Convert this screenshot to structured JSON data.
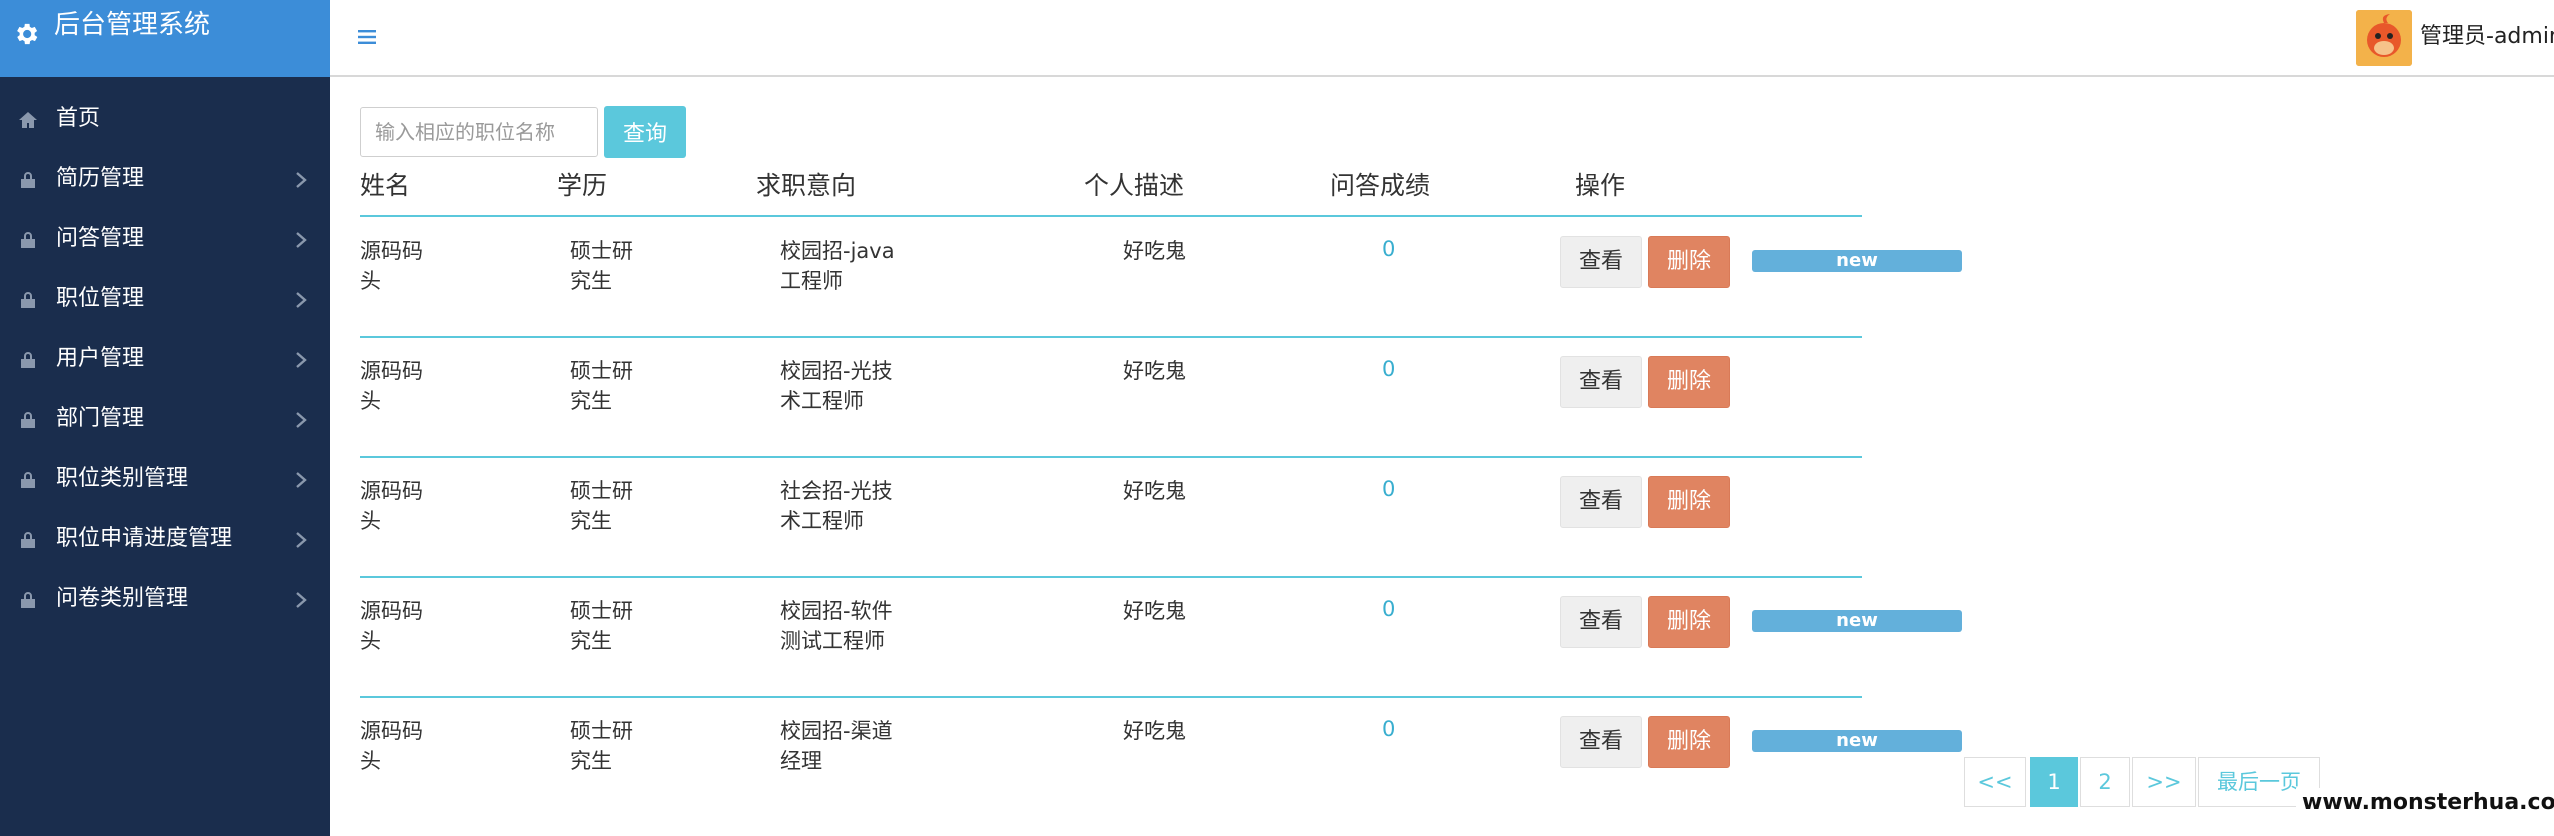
{
  "app": {
    "title": "后台管理系统",
    "user": "管理员-admin"
  },
  "sidebar": {
    "items": [
      {
        "label": "首页",
        "has_children": false
      },
      {
        "label": "简历管理",
        "has_children": true
      },
      {
        "label": "问答管理",
        "has_children": true
      },
      {
        "label": "职位管理",
        "has_children": true
      },
      {
        "label": "用户管理",
        "has_children": true
      },
      {
        "label": "部门管理",
        "has_children": true
      },
      {
        "label": "职位类别管理",
        "has_children": true
      },
      {
        "label": "职位申请进度管理",
        "has_children": true
      },
      {
        "label": "问卷类别管理",
        "has_children": true
      }
    ]
  },
  "search": {
    "placeholder": "输入相应的职位名称",
    "button_label": "查询"
  },
  "table": {
    "columns": [
      "姓名",
      "学历",
      "求职意向",
      "个人描述",
      "问答成绩",
      "操作"
    ],
    "view_label": "查看",
    "delete_label": "删除",
    "badge_label": "new",
    "rows": [
      {
        "name_l1": "源码码",
        "name_l2": "头",
        "edu_l1": "硕士研",
        "edu_l2": "究生",
        "intent_l1": "校园招-java",
        "intent_l2": "工程师",
        "desc": "好吃鬼",
        "score": "0",
        "is_new": true
      },
      {
        "name_l1": "源码码",
        "name_l2": "头",
        "edu_l1": "硕士研",
        "edu_l2": "究生",
        "intent_l1": "校园招-光技",
        "intent_l2": "术工程师",
        "desc": "好吃鬼",
        "score": "0",
        "is_new": false
      },
      {
        "name_l1": "源码码",
        "name_l2": "头",
        "edu_l1": "硕士研",
        "edu_l2": "究生",
        "intent_l1": "社会招-光技",
        "intent_l2": "术工程师",
        "desc": "好吃鬼",
        "score": "0",
        "is_new": false
      },
      {
        "name_l1": "源码码",
        "name_l2": "头",
        "edu_l1": "硕士研",
        "edu_l2": "究生",
        "intent_l1": "校园招-软件",
        "intent_l2": "测试工程师",
        "desc": "好吃鬼",
        "score": "0",
        "is_new": true
      },
      {
        "name_l1": "源码码",
        "name_l2": "头",
        "edu_l1": "硕士研",
        "edu_l2": "究生",
        "intent_l1": "校园招-渠道",
        "intent_l2": "经理",
        "desc": "好吃鬼",
        "score": "0",
        "is_new": true
      }
    ]
  },
  "pagination": {
    "prev": "<<",
    "pages": [
      "1",
      "2"
    ],
    "current": "1",
    "next": ">>",
    "last": "最后一页"
  },
  "watermark": "www.monsterhua.com",
  "colors": {
    "sidebar_bg": "#1a2d4d",
    "brand_bg": "#3c8dd8",
    "accent": "#5bc8dc",
    "delete": "#e08461",
    "badge": "#63b0db"
  },
  "icons": {
    "brand": "gear-icon",
    "menu": "hamburger-icon",
    "nav_home": "home-icon",
    "nav_item": "lock-icon",
    "nav_arrow": "chevron-right-icon"
  }
}
